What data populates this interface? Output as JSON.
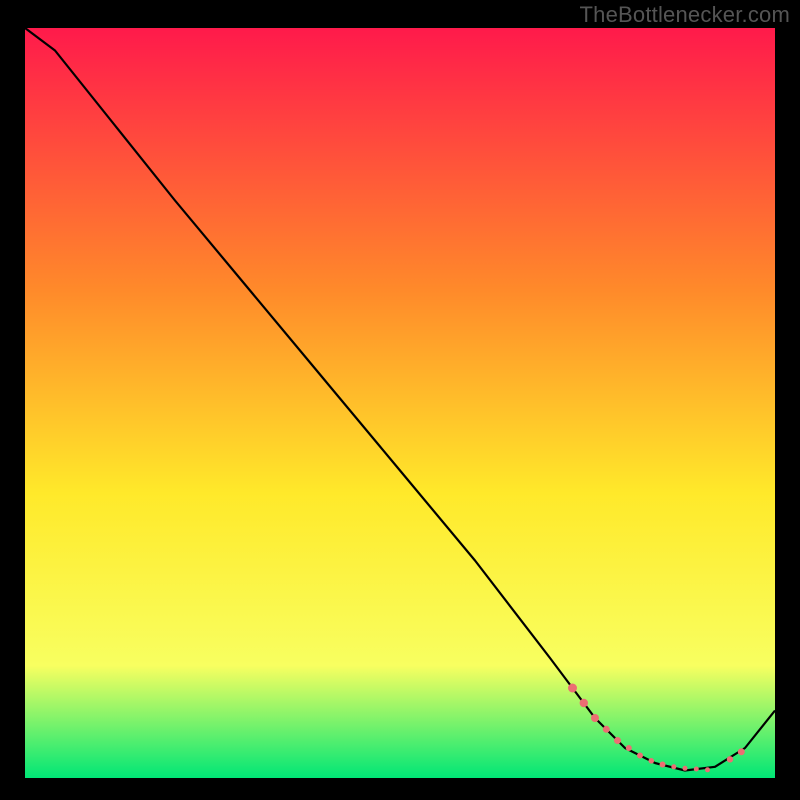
{
  "attribution": "TheBottlenecker.com",
  "gradient": {
    "top": "#ff1a4b",
    "upper_mid": "#ff8a2a",
    "mid": "#ffe92a",
    "lower_mid": "#f8ff60",
    "bottom": "#00e676"
  },
  "chart_data": {
    "type": "line",
    "title": "",
    "xlabel": "",
    "ylabel": "",
    "xlim": [
      0,
      100
    ],
    "ylim": [
      0,
      100
    ],
    "series": [
      {
        "name": "curve",
        "x": [
          0,
          4,
          8,
          12,
          20,
          30,
          40,
          50,
          60,
          70,
          76,
          80,
          84,
          88,
          92,
          96,
          100
        ],
        "y": [
          100,
          97,
          92,
          87,
          77,
          65,
          53,
          41,
          29,
          16,
          8,
          4,
          2,
          1,
          1.5,
          4,
          9
        ]
      }
    ],
    "markers": {
      "name": "highlight-points",
      "color": "#ec6e73",
      "x": [
        73,
        74.5,
        76,
        77.5,
        79,
        80.5,
        82,
        83.5,
        85,
        86.5,
        88,
        89.5,
        91,
        94,
        95.5
      ],
      "y": [
        12,
        10,
        8,
        6.5,
        5,
        4,
        3,
        2.3,
        1.8,
        1.5,
        1.3,
        1.2,
        1.1,
        2.5,
        3.5
      ],
      "r": [
        4.5,
        4.2,
        4.0,
        3.5,
        3.5,
        3.0,
        3.0,
        2.8,
        3.0,
        2.5,
        2.5,
        2.5,
        2.5,
        3.2,
        3.5
      ]
    }
  }
}
